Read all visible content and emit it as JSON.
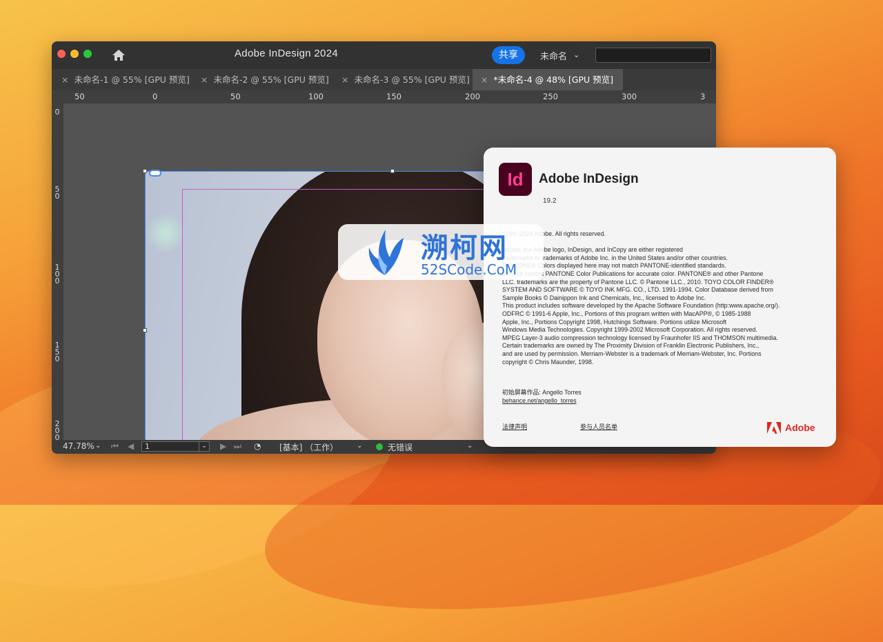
{
  "window": {
    "title": "Adobe InDesign 2024",
    "share_label": "共享",
    "doc_menu_label": "未命名"
  },
  "tabs": [
    {
      "label": "未命名-1 @ 55% [GPU 预览]",
      "active": false
    },
    {
      "label": "未命名-2 @ 55% [GPU 预览]",
      "active": false
    },
    {
      "label": "未命名-3 @ 55% [GPU 预览]",
      "active": false
    },
    {
      "label": "*未命名-4 @ 48% [GPU 预览]",
      "active": true
    }
  ],
  "tab_close_glyph": "×",
  "ruler": {
    "horizontal": [
      "50",
      "0",
      "50",
      "100",
      "150",
      "200",
      "250",
      "300",
      "3"
    ],
    "vertical": [
      "0",
      "50",
      "100",
      "150",
      "200"
    ]
  },
  "statusbar": {
    "zoom": "47.78%",
    "page": "1",
    "mode": "[基本] （工作）",
    "preflight": "无错误"
  },
  "about": {
    "app_name": "Adobe InDesign",
    "logo_text": "Id",
    "version": "19.2",
    "legal_lines": [
      "1999–2024 Adobe. All rights reserved.",
      "",
      "Adobe, the Adobe logo, InDesign, and InCopy are either registered",
      "trademarks or trademarks of Adobe Inc. in the United States and/or other countries.",
      "PANTONE® Colors displayed here may not match PANTONE-identified standards.",
      "Consult current PANTONE Color Publications for accurate color. PANTONE® and other Pantone",
      "LLC. trademarks are the property of Pantone LLC. © Pantone LLC., 2010. TOYO COLOR FINDER®",
      "SYSTEM AND SOFTWARE © TOYO INK MFG. CO., LTD. 1991-1994. Color Database derived from",
      "Sample Books © Dainippon Ink and Chemicals, Inc., licensed to Adobe Inc.",
      "This product includes software developed by the Apache Software Foundation (http:www.apache.org/).",
      "ODFRC © 1991-6 Apple, Inc., Portions of this program written with MacAPP®, © 1985-1988",
      "Apple, Inc., Portions Copyright 1998, Hutchings Software. Portions utilize Microsoft",
      "Windows Media Technologies. Copyright 1999-2002 Microsoft Corporation. All rights reserved.",
      "MPEG Layer-3 audio compression technology licensed by Fraunhofer IIS and THOMSON multimedia.",
      "Certain trademarks are owned by The Proximity Division of Franklin Electronic Publishers, Inc.,",
      "and are used by permission. Merriam-Webster is a trademark of Merriam-Webster, Inc. Portions",
      "copyright © Chris Maunder, 1998."
    ],
    "splash_credit": "初始屏幕作品: Angello Torres",
    "splash_link": "behance.net/angello_torres",
    "legal_notices": "法律声明",
    "credits": "参与人员名单",
    "brand": "Adobe"
  },
  "watermark": {
    "title": "溯柯网",
    "url": "52SCode.CoM"
  },
  "colors": {
    "share_blue": "#1473e6",
    "id_logo_bg": "#49021f",
    "id_logo_fg": "#ff3f94",
    "adobe_red": "#e1251b",
    "watermark_blue": "#2f74d8"
  }
}
